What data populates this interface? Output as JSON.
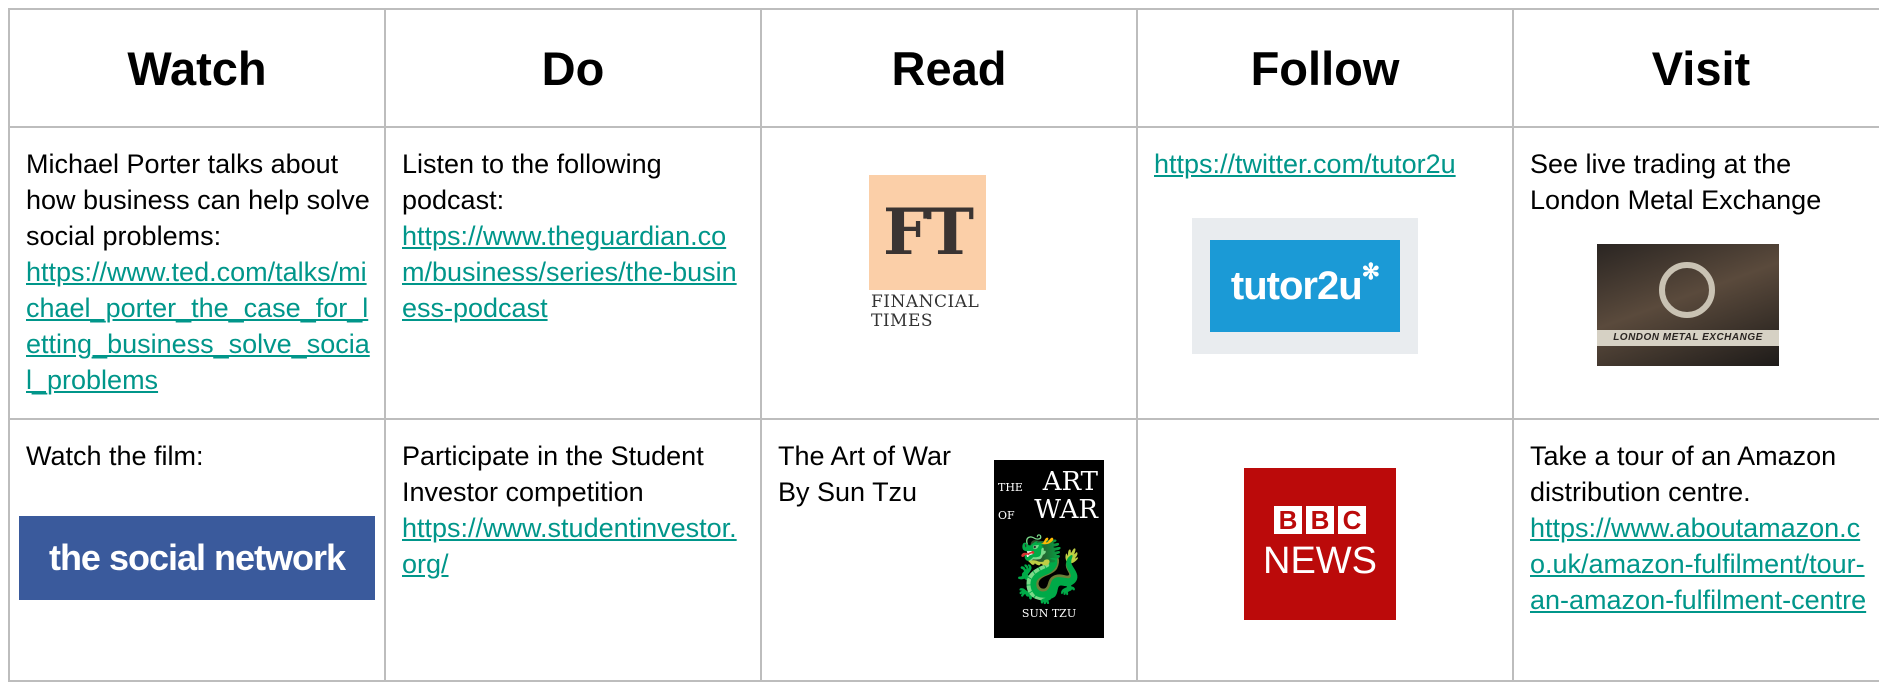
{
  "headers": [
    "Watch",
    "Do",
    "Read",
    "Follow",
    "Visit"
  ],
  "row1": {
    "watch": {
      "text": "Michael Porter talks about how business can help solve social problems:",
      "link": "https://www.ted.com/talks/michael_porter_the_case_for_letting_business_solve_social_problems"
    },
    "do": {
      "text": "Listen to the following podcast:",
      "link": "https://www.theguardian.com/business/series/the-business-podcast"
    },
    "read": {
      "logo_mark": "FT",
      "logo_name_line1": "FINANCIAL",
      "logo_name_line2": "TIMES",
      "logo_color": "#fbcfa8"
    },
    "follow": {
      "link": "https://twitter.com/tutor2u",
      "logo_text": "tutor2u",
      "logo_star": "✻",
      "logo_color": "#1b9ad6"
    },
    "visit": {
      "text": "See live trading at the London Metal Exchange",
      "photo_caption": "LONDON METAL EXCHANGE"
    }
  },
  "row2": {
    "watch": {
      "text": "Watch the film:",
      "logo_text": "the social network",
      "logo_color": "#3a5a9c"
    },
    "do": {
      "text": "Participate in the Student Investor competition",
      "link": "https://www.studentinvestor.org/"
    },
    "read": {
      "text_line1": "The Art of War",
      "text_line2": "By Sun Tzu",
      "cover_the": "THE",
      "cover_art": "ART",
      "cover_of": "OF",
      "cover_war": "WAR",
      "cover_dragon": "🐉",
      "cover_author": "SUN TZU"
    },
    "follow": {
      "logo_b1": "B",
      "logo_b2": "B",
      "logo_c": "C",
      "logo_news": "NEWS",
      "logo_color": "#bb0a0a"
    },
    "visit": {
      "text": "Take a tour of an Amazon distribution centre.",
      "link": "https://www.aboutamazon.co.uk/amazon-fulfilment/tour-an-amazon-fulfilment-centre"
    }
  },
  "colors": {
    "link": "#00968a",
    "border": "#bdbdbd"
  }
}
